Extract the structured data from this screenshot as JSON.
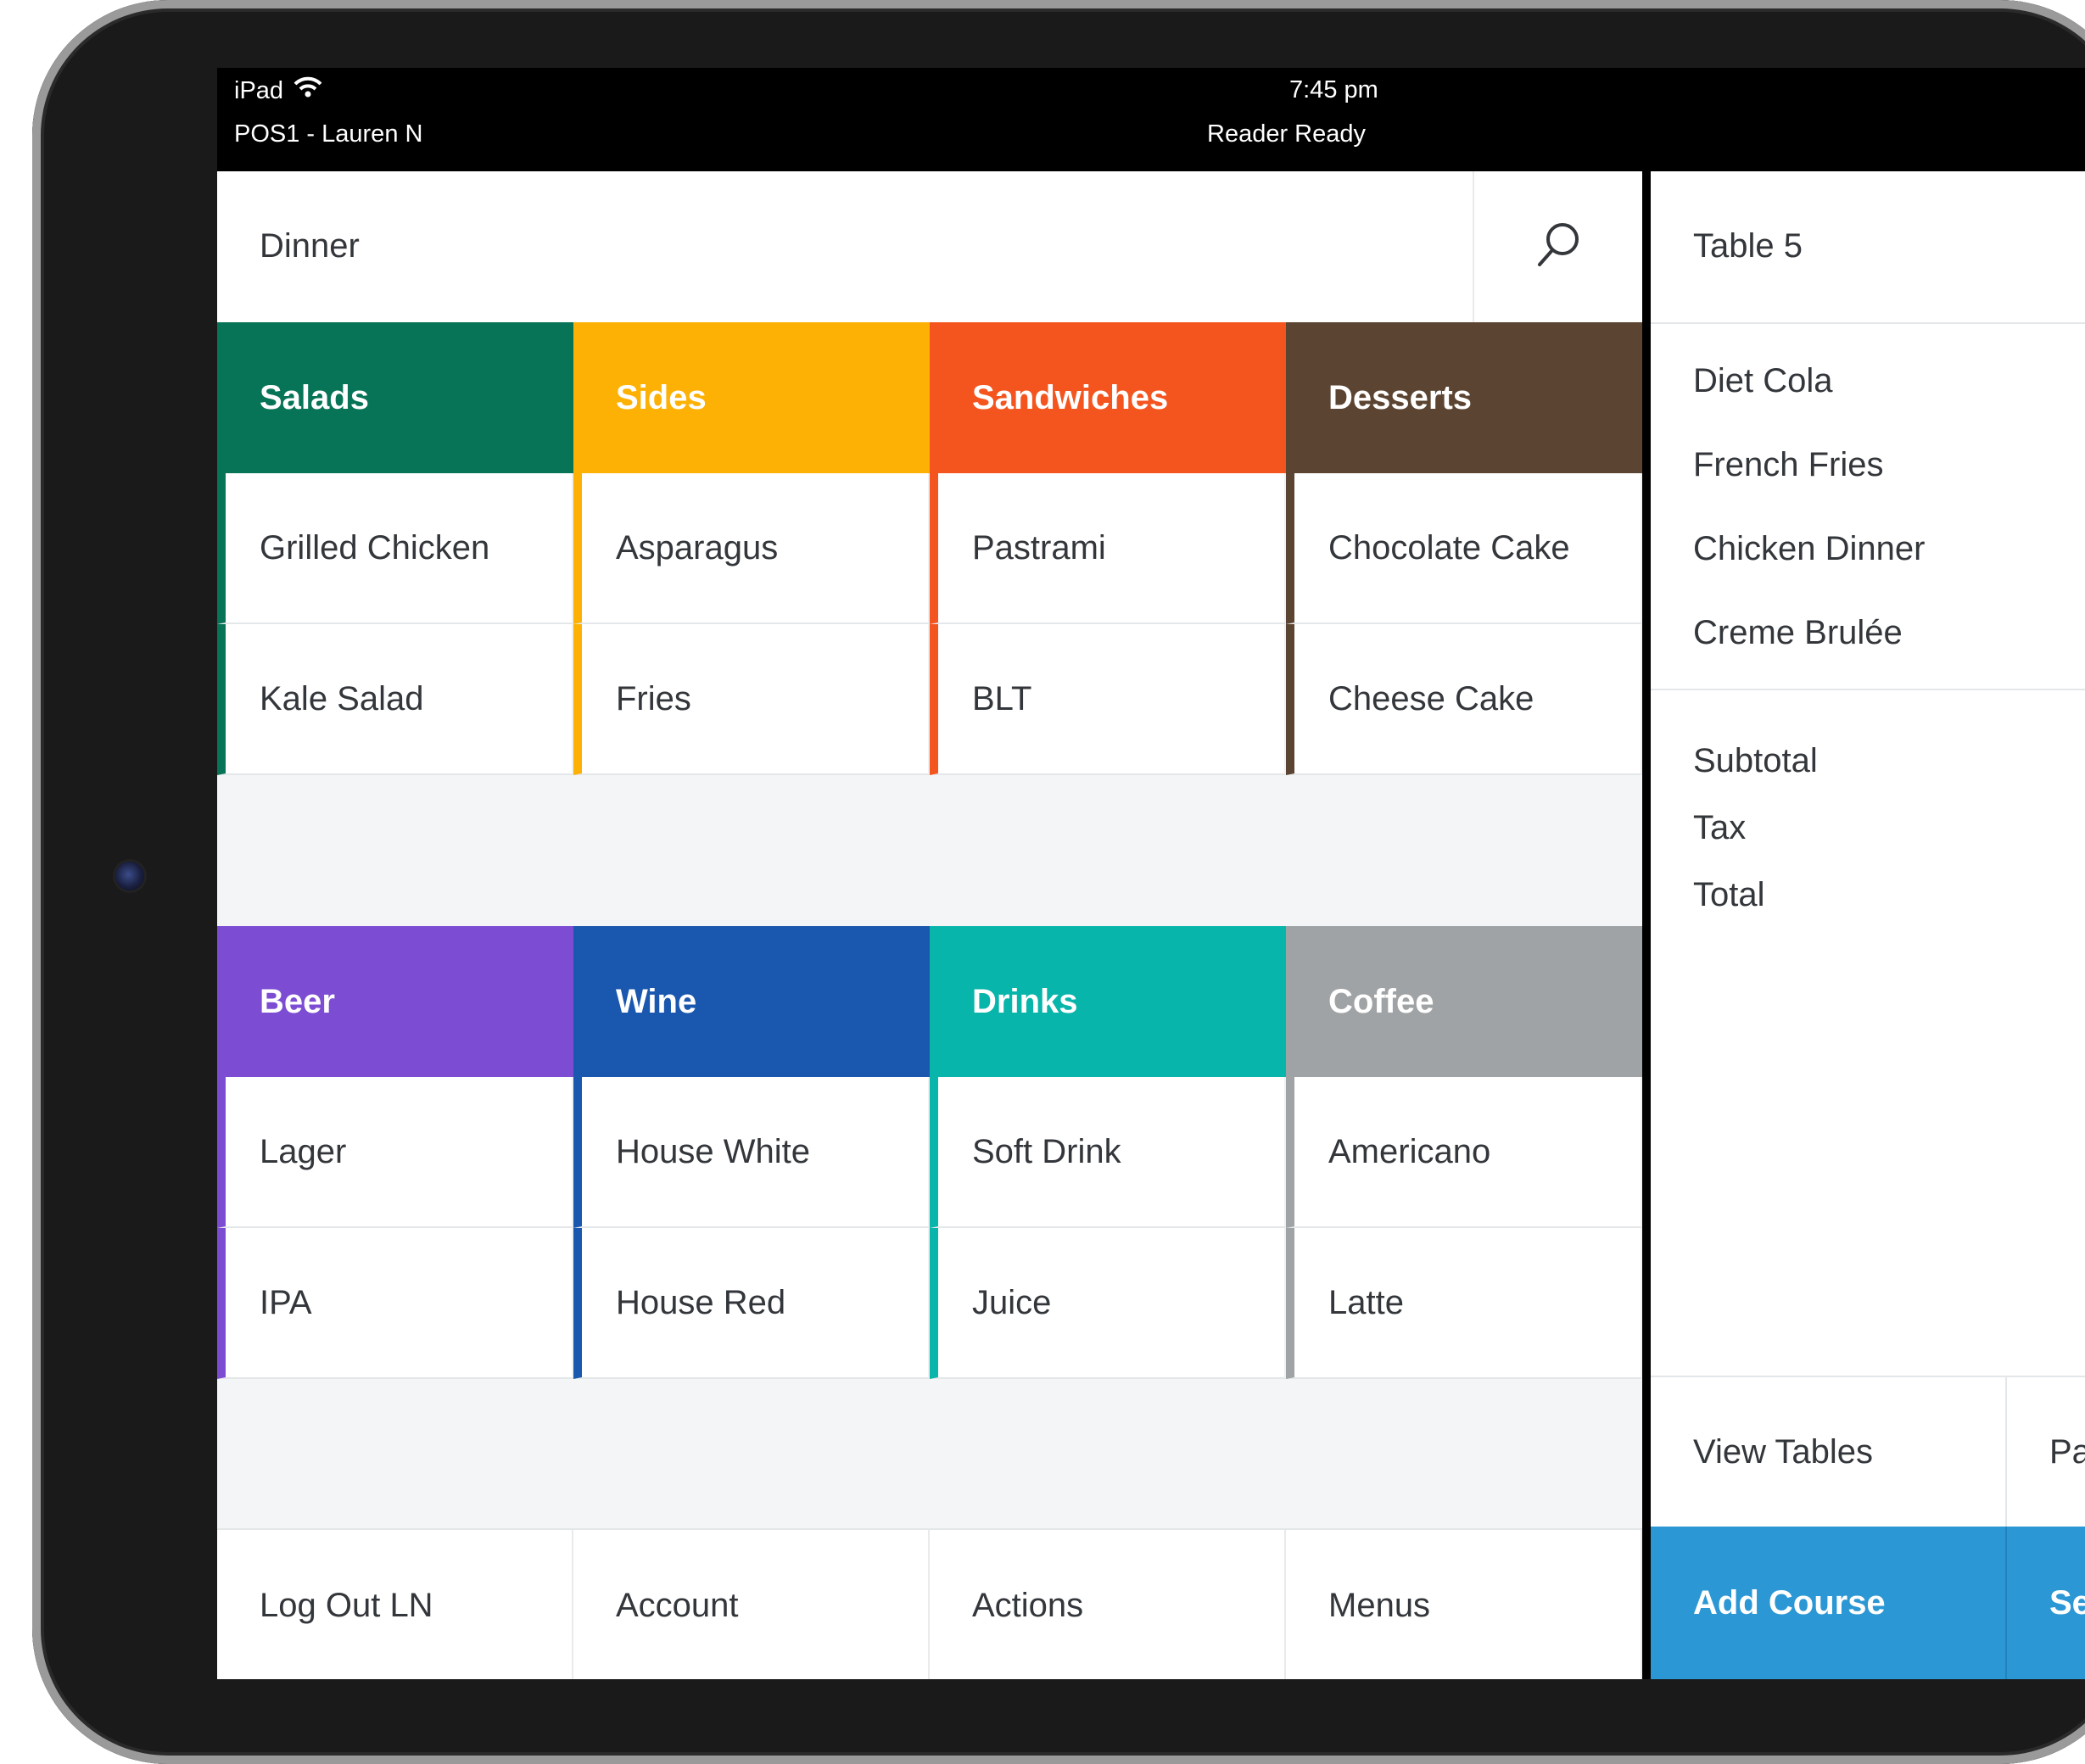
{
  "status_bar": {
    "device": "iPad",
    "terminal": "POS1 - Lauren N",
    "time": "7:45 pm",
    "reader": "Reader Ready"
  },
  "menu": {
    "title": "Dinner",
    "categories_top": [
      {
        "label": "Salads",
        "color": "#077457",
        "items": [
          "Grilled Chicken",
          "Kale Salad"
        ]
      },
      {
        "label": "Sides",
        "color": "#FDB104",
        "items": [
          "Asparagus",
          "Fries"
        ]
      },
      {
        "label": "Sandwiches",
        "color": "#F4551F",
        "items": [
          "Pastrami",
          "BLT"
        ]
      },
      {
        "label": "Desserts",
        "color": "#5B4532",
        "items": [
          "Chocolate Cake",
          "Cheese Cake"
        ]
      }
    ],
    "categories_bottom": [
      {
        "label": "Beer",
        "color": "#7C4CD3",
        "items": [
          "Lager",
          "IPA"
        ]
      },
      {
        "label": "Wine",
        "color": "#1A57AE",
        "items": [
          "House White",
          "House Red"
        ]
      },
      {
        "label": "Drinks",
        "color": "#08B5AA",
        "items": [
          "Soft Drink",
          "Juice"
        ]
      },
      {
        "label": "Coffee",
        "color": "#A0A3A5",
        "items": [
          "Americano",
          "Latte"
        ]
      }
    ]
  },
  "bottom_nav": [
    "Log Out LN",
    "Account",
    "Actions",
    "Menus"
  ],
  "ticket": {
    "title": "Table 5",
    "items": [
      "Diet Cola",
      "French Fries",
      "Chicken Dinner",
      "Creme Brulée"
    ],
    "totals": [
      "Subtotal",
      "Tax",
      "Total"
    ],
    "view_tables": "View Tables",
    "second_action": "Pa",
    "add_course": "Add Course",
    "send": "Se"
  },
  "icons": {
    "search": "search-icon",
    "wifi": "wifi-icon"
  }
}
